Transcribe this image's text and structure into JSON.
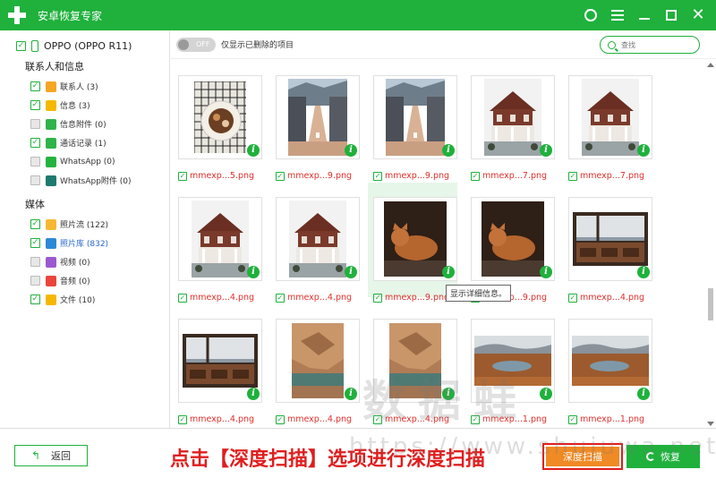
{
  "app": {
    "title": "安卓恢复专家"
  },
  "colors": {
    "brand": "#1fb13c",
    "filename": "#e0302c",
    "hint": "#e01e1e",
    "deep_scan": "#f08a24"
  },
  "titlebar": {
    "icons": [
      "chat-icon",
      "menu-icon",
      "minimize-icon",
      "maximize-icon",
      "close-icon"
    ]
  },
  "sidebar": {
    "device": "OPPO (OPPO R11)",
    "contacts_section": "联系人和信息",
    "contacts_items": [
      {
        "label": "联系人 (3)",
        "checked": true,
        "icon": "contacts-icon",
        "color": "#f5a623"
      },
      {
        "label": "信息 (3)",
        "checked": true,
        "icon": "messages-icon",
        "color": "#f5b800"
      },
      {
        "label": "信息附件 (0)",
        "checked": false,
        "icon": "attachment-icon",
        "color": "#2fb34a"
      },
      {
        "label": "通话记录 (1)",
        "checked": true,
        "icon": "call-log-icon",
        "color": "#2fb34a"
      },
      {
        "label": "WhatsApp (0)",
        "checked": false,
        "icon": "whatsapp-icon",
        "color": "#25b340"
      },
      {
        "label": "WhatsApp附件 (0)",
        "checked": false,
        "icon": "whatsapp-attachment-icon",
        "color": "#1e7a6e"
      }
    ],
    "media_section": "媒体",
    "media_items": [
      {
        "label": "照片流 (122)",
        "checked": true,
        "icon": "photo-stream-icon",
        "color": "#f7b733",
        "active": false
      },
      {
        "label": "照片库 (832)",
        "checked": true,
        "icon": "photo-library-icon",
        "color": "#2d89d6",
        "active": true
      },
      {
        "label": "视频 (0)",
        "checked": false,
        "icon": "video-icon",
        "color": "#9b59d0",
        "active": false
      },
      {
        "label": "音频 (0)",
        "checked": false,
        "icon": "audio-icon",
        "color": "#e8453c",
        "active": false
      },
      {
        "label": "文件 (10)",
        "checked": true,
        "icon": "files-icon",
        "color": "#f5b800",
        "active": false
      }
    ]
  },
  "toolbar": {
    "toggle_state": "OFF",
    "toggle_label": "仅显示已删除的项目",
    "search_placeholder": "查找"
  },
  "grid": {
    "items": [
      {
        "name": "mmexp...5.png",
        "img": "food"
      },
      {
        "name": "mmexp...9.png",
        "img": "street"
      },
      {
        "name": "mmexp...9.png",
        "img": "street"
      },
      {
        "name": "mmexp...7.png",
        "img": "house"
      },
      {
        "name": "mmexp...7.png",
        "img": "house"
      },
      {
        "name": "mmexp...4.png",
        "img": "house"
      },
      {
        "name": "mmexp...4.png",
        "img": "house"
      },
      {
        "name": "mmexp...9.png",
        "img": "cat"
      },
      {
        "name": "mmexp...9.png",
        "img": "cat"
      },
      {
        "name": "mmexp...4.png",
        "img": "window"
      },
      {
        "name": "mmexp...4.png",
        "img": "window"
      },
      {
        "name": "mmexp...4.png",
        "img": "rock"
      },
      {
        "name": "mmexp...4.png",
        "img": "rock"
      },
      {
        "name": "mmexp...1.png",
        "img": "pond"
      },
      {
        "name": "mmexp...1.png",
        "img": "pond"
      }
    ],
    "tooltip": "显示详细信息。"
  },
  "bottom": {
    "back_label": "返回",
    "hint": "点击【深度扫描】选项进行深度扫描",
    "deep_scan_label": "深度扫描",
    "restore_label": "恢复"
  },
  "watermark": {
    "text": "数据蛙",
    "url": "https://www.shujuwa.net"
  }
}
